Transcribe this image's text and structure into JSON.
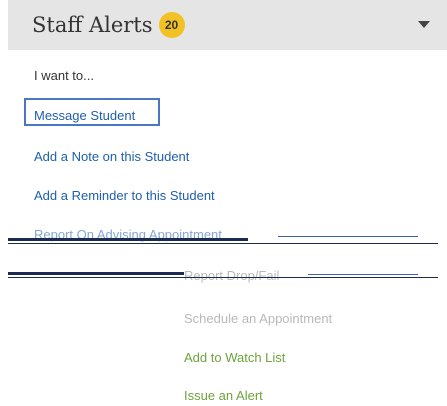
{
  "header": {
    "title": "Staff Alerts",
    "badge_count": "20"
  },
  "menu": {
    "intro": "I want to...",
    "items": [
      {
        "label": "Message Student"
      },
      {
        "label": "Add a Note on this Student"
      },
      {
        "label": "Add a Reminder to this Student"
      },
      {
        "label": "Report On Advising Appointment"
      },
      {
        "label": "Report Drop/Fail"
      },
      {
        "label": "Schedule an Appointment"
      },
      {
        "label": "Add to Watch List"
      },
      {
        "label": "Issue an Alert"
      }
    ]
  },
  "colors": {
    "header_bg": "#e5e5e5",
    "badge": "#f2c224",
    "link": "#1f5fad",
    "focus_border": "#4a76c4",
    "green_link": "#6ea33d"
  },
  "icons": {
    "dropdown": "chevron-down-icon"
  }
}
